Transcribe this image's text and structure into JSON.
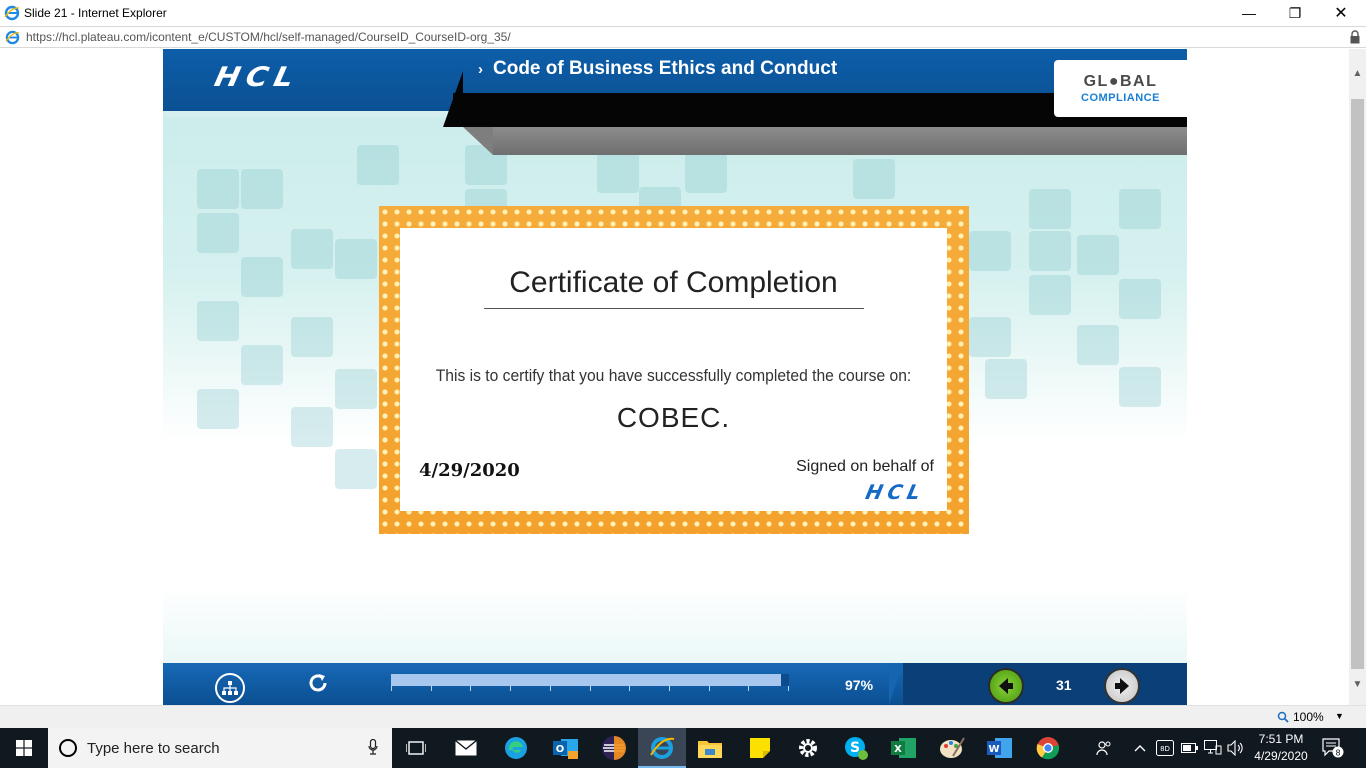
{
  "window": {
    "title": "Slide 21 - Internet Explorer",
    "minimize": "—",
    "maximize": "❐",
    "close": "✕"
  },
  "address": {
    "url": "https://hcl.plateau.com/icontent_e/CUSTOM/hcl/self-managed/CourseID_CourseID-org_35/"
  },
  "header": {
    "logo": "HCL",
    "chevron": "›",
    "course_title": "Code of Business Ethics and Conduct",
    "badge_line1": "GL●BAL",
    "badge_line2": "COMPLIANCE"
  },
  "certificate": {
    "title": "Certificate of Completion",
    "statement": "This is to certify that you have successfully completed the course on:",
    "course": "COBEC.",
    "date": "4/29/2020",
    "signed": "Signed on behalf of",
    "signer_logo": "HCL"
  },
  "footer": {
    "progress_fraction": 0.98,
    "progress_label": "97%",
    "page_number": "31"
  },
  "statusbar": {
    "zoom": "100%"
  },
  "taskbar": {
    "search_placeholder": "Type here to search",
    "clock_time": "7:51 PM",
    "clock_date": "4/29/2020",
    "notification_count": "8"
  },
  "colors": {
    "hcl_blue": "#0b4f92",
    "cert_border": "#f6ac3a",
    "progress_fill": "#a7c7ee",
    "taskbar": "#101820"
  }
}
